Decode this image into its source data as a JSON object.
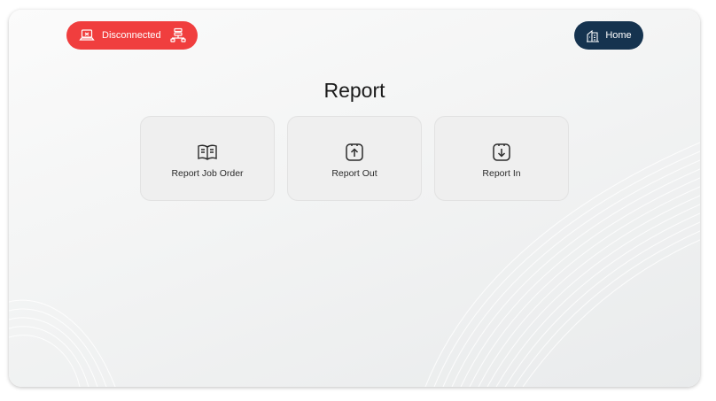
{
  "status": {
    "label": "Disconnected",
    "lead_icon": "laptop-icon",
    "trail_icon": "network-icon",
    "color": "#f03e3e"
  },
  "home": {
    "label": "Home",
    "icon": "home-building-icon",
    "color": "#15334f"
  },
  "page": {
    "title": "Report"
  },
  "cards": [
    {
      "label": "Report Job Order",
      "icon": "open-book-icon"
    },
    {
      "label": "Report Out",
      "icon": "upload-box-icon"
    },
    {
      "label": "Report In",
      "icon": "download-box-icon"
    }
  ]
}
